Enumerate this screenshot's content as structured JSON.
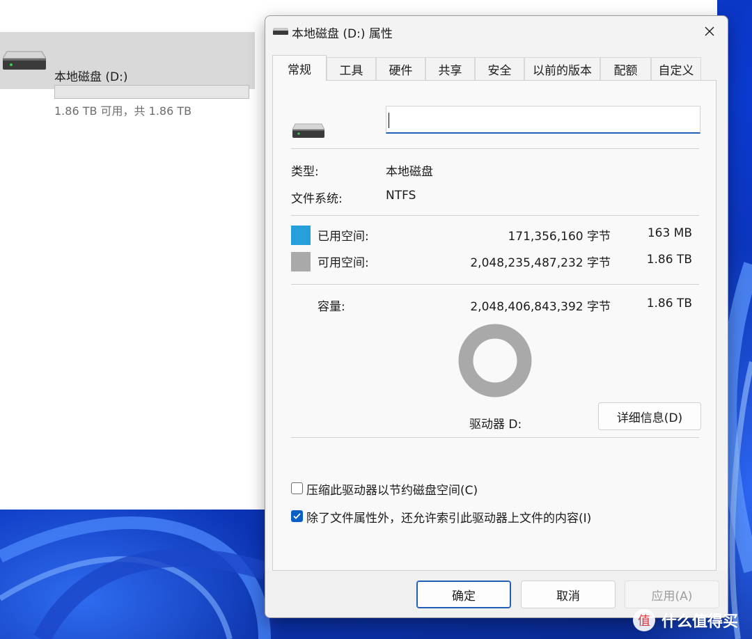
{
  "explorer": {
    "drive_name": "本地磁盘 (D:)",
    "drive_free_text": "1.86 TB 可用，共 1.86 TB",
    "drive_used_fraction": 0.0001
  },
  "dialog": {
    "title": "本地磁盘 (D:) 属性",
    "close_icon": "close-icon",
    "tabs": [
      "常规",
      "工具",
      "硬件",
      "共享",
      "安全",
      "以前的版本",
      "配额",
      "自定义"
    ],
    "active_tab": "常规",
    "label_value": "",
    "type_label": "类型:",
    "type_value": "本地磁盘",
    "fs_label": "文件系统:",
    "fs_value": "NTFS",
    "used_label": "已用空间:",
    "used_bytes": "171,356,160 字节",
    "used_size": "163 MB",
    "free_label": "可用空间:",
    "free_bytes": "2,048,235,487,232 字节",
    "free_size": "1.86 TB",
    "capacity_label": "容量:",
    "capacity_bytes": "2,048,406,843,392 字节",
    "capacity_size": "1.86 TB",
    "used_fraction": 0.0001,
    "drive_label": "驱动器 D:",
    "details_button": "详细信息(D)",
    "compress_label": "压缩此驱动器以节约磁盘空间(C)",
    "compress_checked": false,
    "index_label": "除了文件属性外，还允许索引此驱动器上文件的内容(I)",
    "index_checked": true,
    "ok_button": "确定",
    "cancel_button": "取消",
    "apply_button": "应用(A)"
  },
  "colors": {
    "used": "#26a0da",
    "free": "#a9a9a9",
    "accent": "#1f5fb5"
  },
  "watermark": {
    "text": "什么值得买",
    "logo_char": "值"
  }
}
